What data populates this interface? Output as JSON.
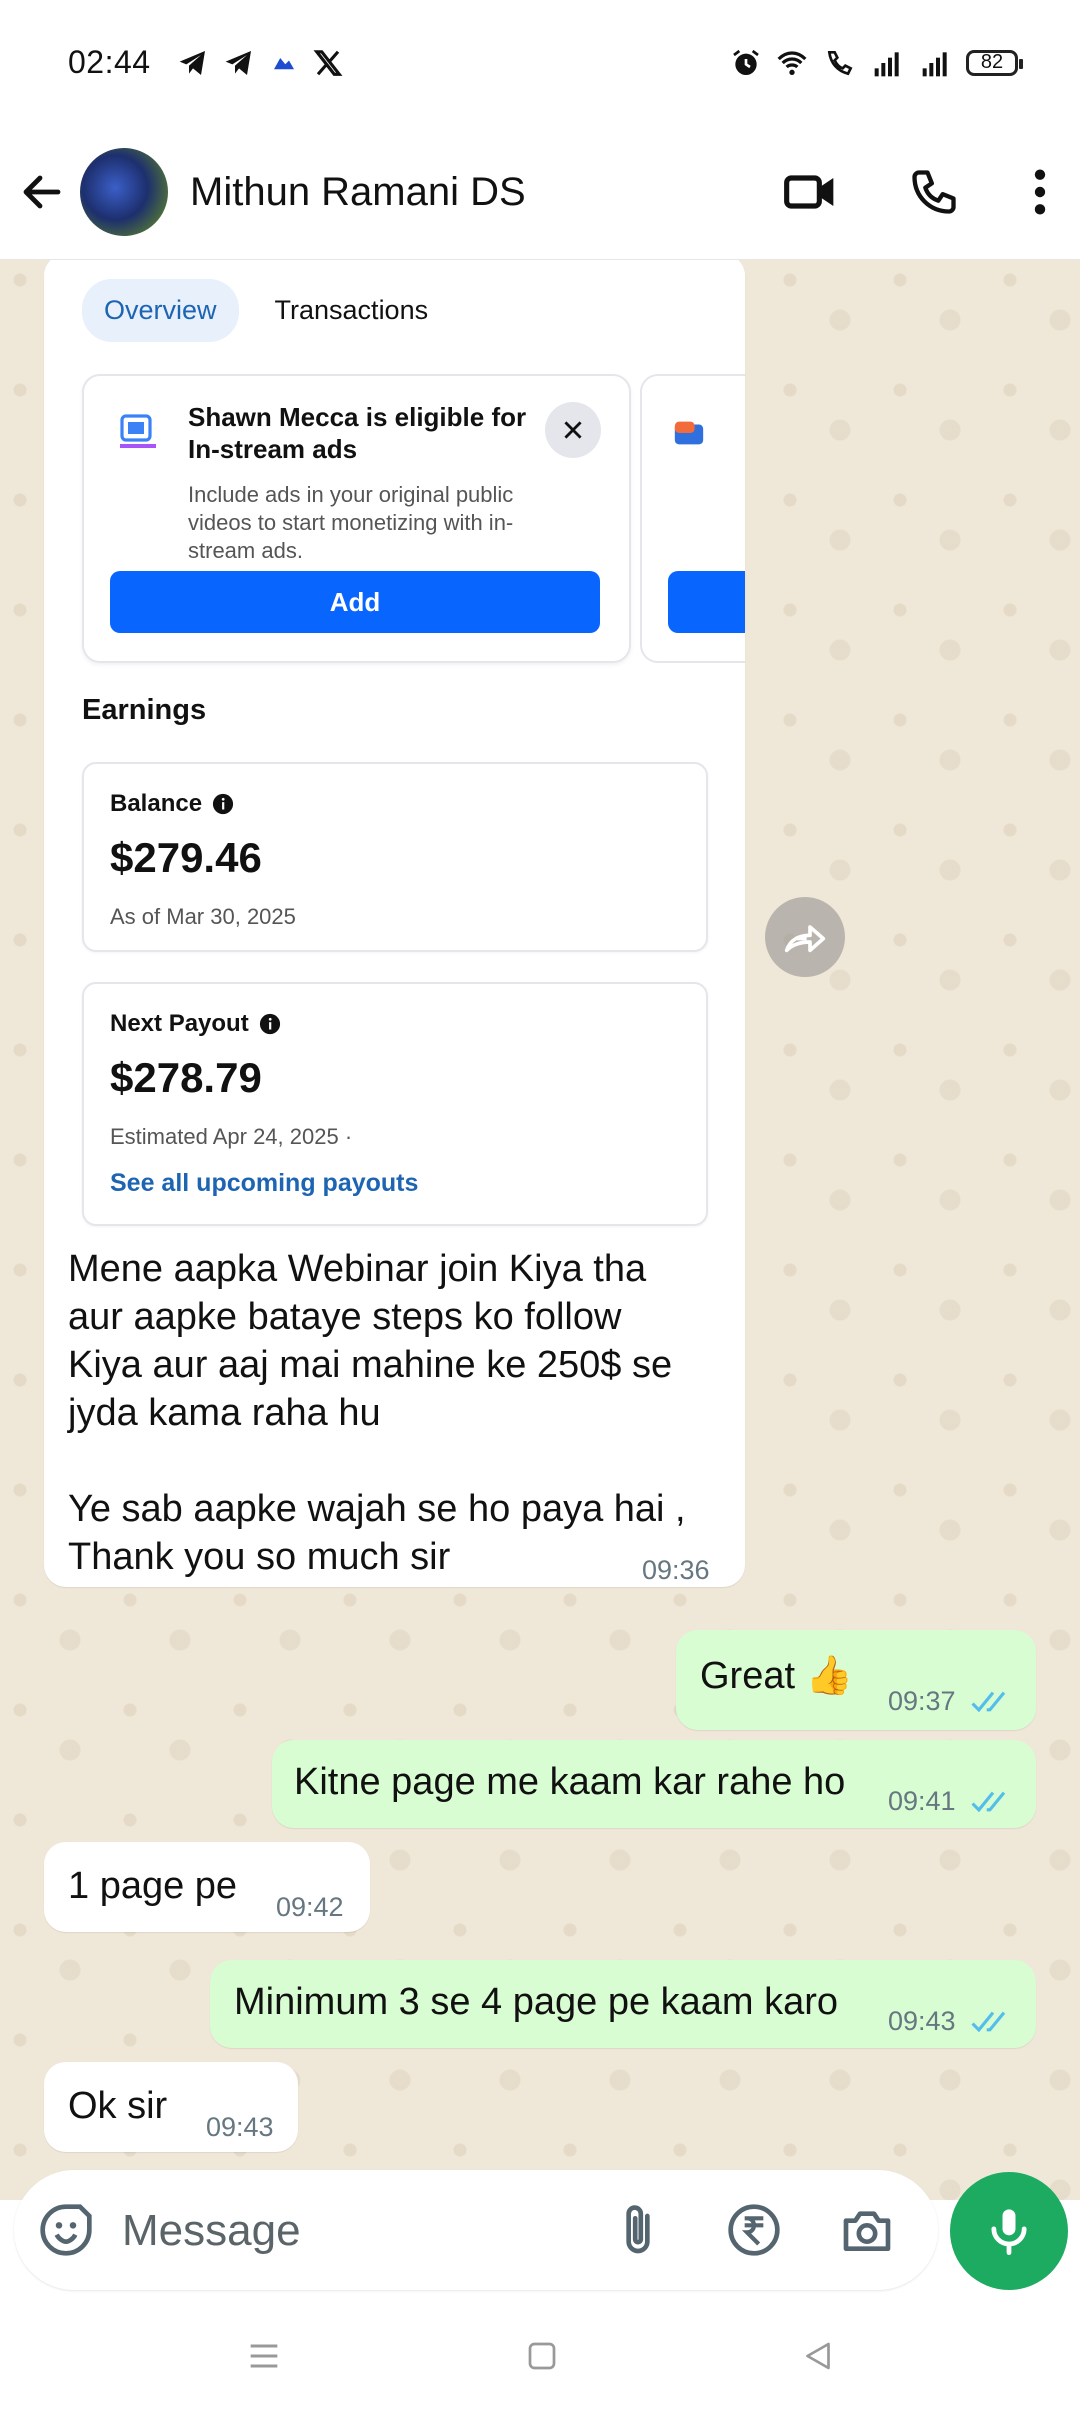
{
  "status_bar": {
    "time": "02:44",
    "left_icons": [
      "telegram-icon",
      "telegram-icon",
      "cloud-icon",
      "x-icon"
    ],
    "right_icons": [
      "alarm-icon",
      "wifi-icon",
      "wifi-call-icon",
      "signal-icon",
      "signal-icon"
    ],
    "battery": "82"
  },
  "header": {
    "contact_name": "Mithun Ramani DS",
    "icons": [
      "back-arrow-icon",
      "video-call-icon",
      "phone-icon",
      "more-vert-icon"
    ]
  },
  "screenshot": {
    "tabs": [
      "Overview",
      "Transactions"
    ],
    "eligible_title": "Shawn Mecca is eligible for In-stream ads",
    "eligible_desc": "Include ads in your original public videos to start monetizing with in-stream ads.",
    "add_label": "Add",
    "earnings_heading": "Earnings",
    "balance_label": "Balance",
    "balance_amount": "$279.46",
    "balance_date": "As of Mar 30, 2025",
    "payout_label": "Next Payout",
    "payout_amount": "$278.79",
    "payout_date": "Estimated Apr 24, 2025 ·",
    "payout_link": "See all upcoming payouts"
  },
  "messages": [
    {
      "dir": "in",
      "text_lines": [
        "Mene aapka Webinar join Kiya tha",
        "aur aapke bataye steps ko follow",
        "Kiya aur aaj mai mahine ke 250$ se",
        "jyda kama raha hu",
        "",
        "Ye sab aapke wajah se ho paya hai ,",
        "Thank you so much sir"
      ],
      "time": "09:36"
    },
    {
      "dir": "out",
      "text": "Great 👍",
      "time": "09:37",
      "status": "read"
    },
    {
      "dir": "out",
      "text": "Kitne page me kaam kar rahe ho",
      "time": "09:41",
      "status": "read"
    },
    {
      "dir": "in",
      "text": "1 page pe",
      "time": "09:42"
    },
    {
      "dir": "out",
      "text": "Minimum 3 se 4 page pe kaam karo",
      "time": "09:43",
      "status": "read"
    },
    {
      "dir": "in",
      "text": "Ok sir",
      "time": "09:43"
    }
  ],
  "composer": {
    "placeholder": "Message",
    "icons": [
      "emoji-icon",
      "attach-icon",
      "rupee-payment-icon",
      "camera-icon",
      "mic-icon"
    ]
  },
  "colors": {
    "chat_bg": "#efe7d8",
    "outgoing_bubble": "#d9fdd3",
    "incoming_bubble": "#ffffff",
    "read_tick": "#53bdeb",
    "mic_button": "#1daa61",
    "fb_blue": "#0866ff"
  }
}
